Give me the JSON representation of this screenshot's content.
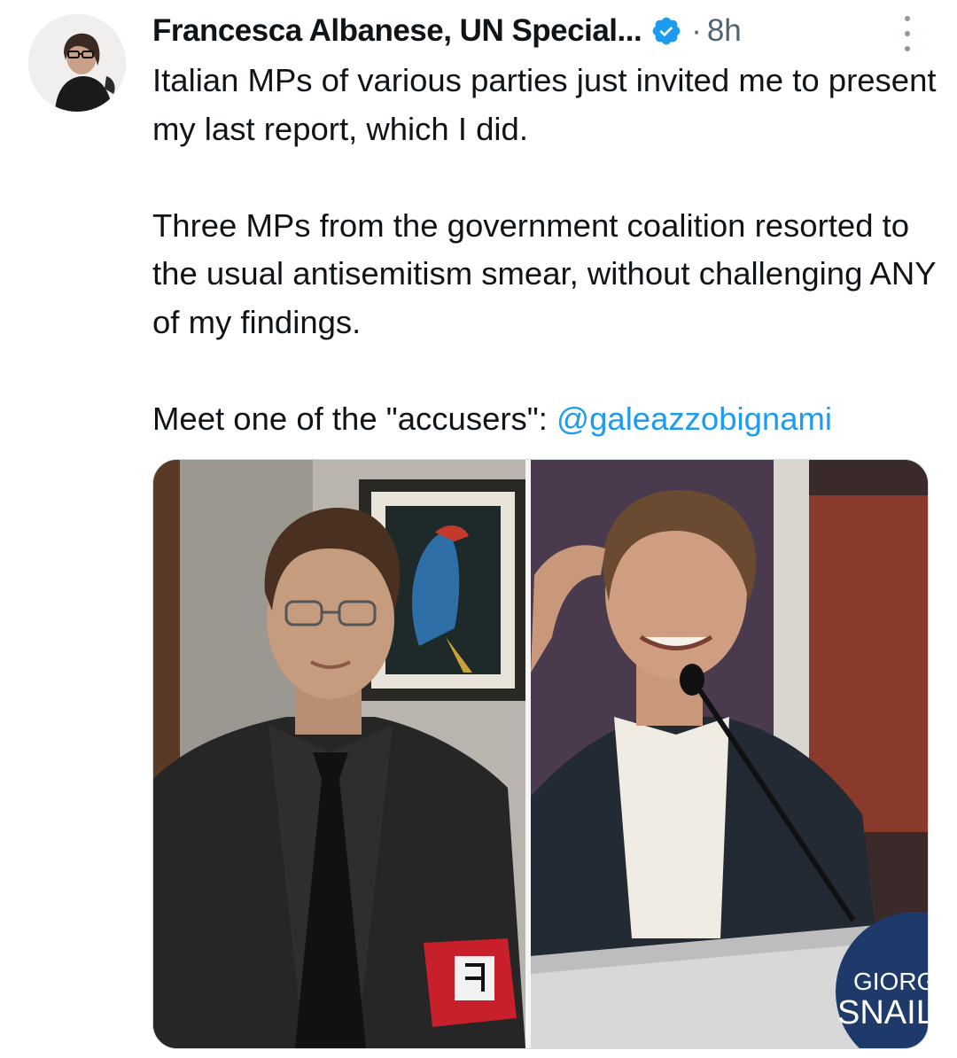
{
  "tweet": {
    "author_name": "Francesca Albanese, UN Special...",
    "separator": "·",
    "time": "8h",
    "paragraphs": [
      "Italian MPs of various parties just invited me to present my last report, which I did.",
      "Three MPs from the government coalition resorted to the usual antisemitism smear, without challenging ANY of my findings."
    ],
    "meet_prefix": "Meet one of the \"accusers\": ",
    "mention": "@galeazzobignami"
  },
  "media": {
    "podium_sign_line1": "GIORG",
    "podium_sign_line2": "SNAIL"
  },
  "icons": {
    "verified": "verified-badge-icon",
    "more": "more-options-icon"
  },
  "colors": {
    "accent": "#1d9bf0",
    "secondary_text": "#536471",
    "primary_text": "#0f1419"
  }
}
